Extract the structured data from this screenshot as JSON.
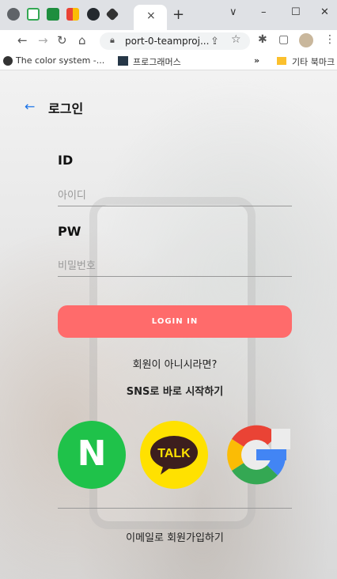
{
  "browser": {
    "tab_close": "×",
    "new_tab": "+",
    "url": "port-0-teamproj...",
    "bookmark1": "The color system -...",
    "bookmark2": "프로그래머스",
    "bookmark_overflow": "»",
    "other_bookmarks": "기타 북마크",
    "window_controls": [
      "∨",
      "–",
      "☐",
      "✕"
    ]
  },
  "login": {
    "title": "로그인",
    "back_icon": "arrow-left-icon",
    "id_label": "ID",
    "id_placeholder": "아이디",
    "pw_label": "PW",
    "pw_placeholder": "비밀번호",
    "button": "LOGIN IN",
    "not_member": "회원이 아니시라면?",
    "sns_start": "SNS로 바로 시작하기",
    "naver_letter": "N",
    "kakao_text": "TALK",
    "email_signup": "이메일로 회원가입하기"
  },
  "colors": {
    "login_button": "#ff6b6b",
    "naver": "#1fc24a",
    "kakao": "#ffe100",
    "back_arrow": "#1a73e8"
  }
}
